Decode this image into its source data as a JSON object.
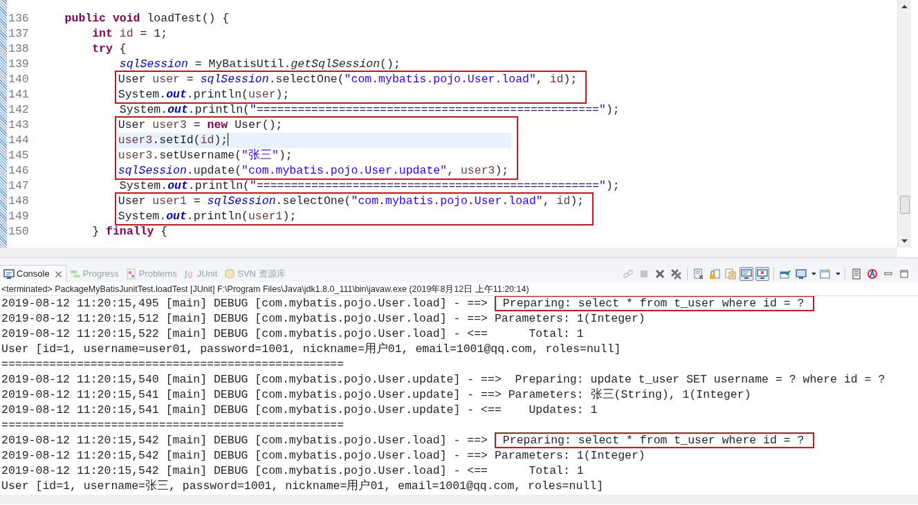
{
  "editor": {
    "blocks": [
      {
        "boxed": false,
        "lines": [
          {
            "number": "136",
            "current": false,
            "tokens": [
              {
                "kind": "keyword",
                "text": "    public void"
              },
              {
                "kind": "plain",
                "text": " loadTest() {"
              }
            ]
          },
          {
            "number": "137",
            "current": false,
            "tokens": [
              {
                "kind": "keyword",
                "text": "        int "
              },
              {
                "kind": "local",
                "text": "id"
              },
              {
                "kind": "plain",
                "text": " = 1;"
              }
            ]
          },
          {
            "number": "138",
            "current": false,
            "tokens": [
              {
                "kind": "keyword",
                "text": "        try"
              },
              {
                "kind": "plain",
                "text": " {"
              }
            ]
          },
          {
            "number": "139",
            "current": false,
            "tokens": [
              {
                "kind": "field",
                "text": "            sqlSession"
              },
              {
                "kind": "plain",
                "text": " = MyBatisUtil."
              },
              {
                "kind": "static_method",
                "text": "getSqlSession"
              },
              {
                "kind": "plain",
                "text": "();"
              }
            ]
          }
        ]
      },
      {
        "boxed": true,
        "lines": [
          {
            "number": "140",
            "current": false,
            "tokens": [
              {
                "kind": "plain",
                "text": "User "
              },
              {
                "kind": "local",
                "text": "user"
              },
              {
                "kind": "plain",
                "text": " = "
              },
              {
                "kind": "field",
                "text": "sqlSession"
              },
              {
                "kind": "plain",
                "text": ".selectOne("
              },
              {
                "kind": "string",
                "text": "\"com.mybatis.pojo.User.load\""
              },
              {
                "kind": "plain",
                "text": ", "
              },
              {
                "kind": "local",
                "text": "id"
              },
              {
                "kind": "plain",
                "text": ");"
              }
            ]
          },
          {
            "number": "141",
            "current": false,
            "tokens": [
              {
                "kind": "plain",
                "text": "System."
              },
              {
                "kind": "static_field",
                "text": "out"
              },
              {
                "kind": "plain",
                "text": ".println("
              },
              {
                "kind": "local",
                "text": "user"
              },
              {
                "kind": "plain",
                "text": ");"
              }
            ]
          }
        ]
      },
      {
        "boxed": false,
        "lines": [
          {
            "number": "142",
            "current": false,
            "tokens": [
              {
                "kind": "plain",
                "text": "            System."
              },
              {
                "kind": "static_field",
                "text": "out"
              },
              {
                "kind": "plain",
                "text": ".println("
              },
              {
                "kind": "string",
                "text": "\"==================================================\""
              },
              {
                "kind": "plain",
                "text": ");"
              }
            ]
          }
        ]
      },
      {
        "boxed": true,
        "lines": [
          {
            "number": "143",
            "current": false,
            "tokens": [
              {
                "kind": "plain",
                "text": "User "
              },
              {
                "kind": "local",
                "text": "user3"
              },
              {
                "kind": "plain",
                "text": " = "
              },
              {
                "kind": "keyword",
                "text": "new"
              },
              {
                "kind": "plain",
                "text": " User();"
              }
            ]
          },
          {
            "number": "144",
            "current": true,
            "tokens": [
              {
                "kind": "local",
                "text": "user3"
              },
              {
                "kind": "plain",
                "text": ".setId("
              },
              {
                "kind": "local",
                "text": "id"
              },
              {
                "kind": "plain",
                "text": ");"
              }
            ]
          },
          {
            "number": "145",
            "current": false,
            "tokens": [
              {
                "kind": "local",
                "text": "user3"
              },
              {
                "kind": "plain",
                "text": ".setUsername("
              },
              {
                "kind": "string",
                "text": "\"张三\""
              },
              {
                "kind": "plain",
                "text": ");"
              }
            ]
          },
          {
            "number": "146",
            "current": false,
            "tokens": [
              {
                "kind": "field",
                "text": "sqlSession"
              },
              {
                "kind": "plain",
                "text": ".update("
              },
              {
                "kind": "string",
                "text": "\"com.mybatis.pojo.User.update\""
              },
              {
                "kind": "plain",
                "text": ", "
              },
              {
                "kind": "local",
                "text": "user3"
              },
              {
                "kind": "plain",
                "text": ");"
              }
            ]
          }
        ]
      },
      {
        "boxed": false,
        "lines": [
          {
            "number": "147",
            "current": false,
            "tokens": [
              {
                "kind": "plain",
                "text": "            System."
              },
              {
                "kind": "static_field",
                "text": "out"
              },
              {
                "kind": "plain",
                "text": ".println("
              },
              {
                "kind": "string",
                "text": "\"==================================================\""
              },
              {
                "kind": "plain",
                "text": ");"
              }
            ]
          }
        ]
      },
      {
        "boxed": true,
        "lines": [
          {
            "number": "148",
            "current": false,
            "tokens": [
              {
                "kind": "plain",
                "text": "User "
              },
              {
                "kind": "local",
                "text": "user1"
              },
              {
                "kind": "plain",
                "text": " = "
              },
              {
                "kind": "field",
                "text": "sqlSession"
              },
              {
                "kind": "plain",
                "text": ".selectOne("
              },
              {
                "kind": "string",
                "text": "\"com.mybatis.pojo.User.load\""
              },
              {
                "kind": "plain",
                "text": ", "
              },
              {
                "kind": "local",
                "text": "id"
              },
              {
                "kind": "plain",
                "text": ");"
              }
            ]
          },
          {
            "number": "149",
            "current": false,
            "tokens": [
              {
                "kind": "plain",
                "text": "System."
              },
              {
                "kind": "static_field",
                "text": "out"
              },
              {
                "kind": "plain",
                "text": ".println("
              },
              {
                "kind": "local",
                "text": "user1"
              },
              {
                "kind": "plain",
                "text": ");"
              }
            ]
          }
        ]
      },
      {
        "boxed": false,
        "lines": [
          {
            "number": "150",
            "current": false,
            "tokens": [
              {
                "kind": "plain",
                "text": "        } "
              },
              {
                "kind": "keyword",
                "text": "finally"
              },
              {
                "kind": "plain",
                "text": " {"
              }
            ]
          }
        ]
      }
    ]
  },
  "console": {
    "tabs": [
      {
        "label": "Console",
        "kind": "console",
        "selected": true,
        "closable": true
      },
      {
        "label": "Progress",
        "kind": "progress",
        "selected": false,
        "closable": false
      },
      {
        "label": "Problems",
        "kind": "problems",
        "selected": false,
        "closable": false
      },
      {
        "label": "JUnit",
        "kind": "junit",
        "selected": false,
        "closable": false
      },
      {
        "label": "SVN 资源库",
        "kind": "svn",
        "selected": false,
        "closable": false
      }
    ],
    "toolbar": [
      {
        "kind": "link",
        "disabled": true
      },
      {
        "kind": "stop",
        "disabled": true
      },
      {
        "kind": "remove"
      },
      {
        "kind": "remove-all"
      },
      {
        "kind": "separator"
      },
      {
        "kind": "clear"
      },
      {
        "kind": "lock"
      },
      {
        "kind": "wrap"
      },
      {
        "kind": "stdout",
        "pressed": true
      },
      {
        "kind": "stderr",
        "pressed": true
      },
      {
        "kind": "separator"
      },
      {
        "kind": "pin"
      },
      {
        "kind": "display"
      },
      {
        "kind": "caret"
      },
      {
        "kind": "new"
      },
      {
        "kind": "caret"
      },
      {
        "kind": "separator"
      },
      {
        "kind": "document"
      },
      {
        "kind": "circle"
      },
      {
        "kind": "minimize"
      },
      {
        "kind": "maximize"
      }
    ],
    "process": "<terminated> PackageMyBatisJunitTest.loadTest [JUnit] F:\\Program Files\\Java\\jdk1.8.0_111\\bin\\javaw.exe (2019年8月12日 上午11:20:14)",
    "lines": [
      {
        "text": "2019-08-12 11:20:15,495 [main] DEBUG [com.mybatis.pojo.User.load] - ==> ",
        "boxed_text": " Preparing: select * from t_user where id = ?"
      },
      {
        "text": "2019-08-12 11:20:15,512 [main] DEBUG [com.mybatis.pojo.User.load] - ==> Parameters: 1(Integer)"
      },
      {
        "text": "2019-08-12 11:20:15,522 [main] DEBUG [com.mybatis.pojo.User.load] - <==      Total: 1"
      },
      {
        "text": "User [id=1, username=user01, password=1001, nickname=用户01, email=1001@qq.com, roles=null]"
      },
      {
        "text": "=================================================="
      },
      {
        "text": "2019-08-12 11:20:15,540 [main] DEBUG [com.mybatis.pojo.User.update] - ==>  Preparing: update t_user SET username = ? where id = ?"
      },
      {
        "text": "2019-08-12 11:20:15,541 [main] DEBUG [com.mybatis.pojo.User.update] - ==> Parameters: 张三(String), 1(Integer)"
      },
      {
        "text": "2019-08-12 11:20:15,541 [main] DEBUG [com.mybatis.pojo.User.update] - <==    Updates: 1"
      },
      {
        "text": "=================================================="
      },
      {
        "text": "2019-08-12 11:20:15,542 [main] DEBUG [com.mybatis.pojo.User.load] - ==> ",
        "boxed_text": " Preparing: select * from t_user where id = ?"
      },
      {
        "text": "2019-08-12 11:20:15,542 [main] DEBUG [com.mybatis.pojo.User.load] - ==> Parameters: 1(Integer)"
      },
      {
        "text": "2019-08-12 11:20:15,542 [main] DEBUG [com.mybatis.pojo.User.load] - <==      Total: 1"
      },
      {
        "text": "User [id=1, username=张三, password=1001, nickname=用户01, email=1001@qq.com, roles=null]"
      }
    ]
  }
}
